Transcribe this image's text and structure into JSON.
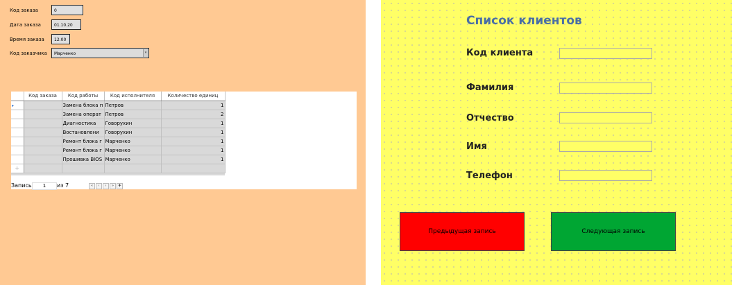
{
  "order_form": {
    "fields": [
      {
        "label": "Код заказа",
        "value": "0"
      },
      {
        "label": "Дата заказа",
        "value": "01.10.20"
      },
      {
        "label": "Время заказа",
        "value": "12:00"
      },
      {
        "label": "Код заказчика",
        "value": "Марченко"
      }
    ],
    "grid": {
      "columns": [
        "Код заказа",
        "Код работы",
        "Код исполнителя",
        "Количество единиц"
      ],
      "rows": [
        {
          "order": "",
          "work": "Замена блока п",
          "executor": "Петров",
          "qty": "1"
        },
        {
          "order": "",
          "work": "Замена операт",
          "executor": "Петров",
          "qty": "2"
        },
        {
          "order": "",
          "work": "Диагностика",
          "executor": "Говорухин",
          "qty": "1"
        },
        {
          "order": "",
          "work": "Востановлени",
          "executor": "Говорухин",
          "qty": "1"
        },
        {
          "order": "",
          "work": "Ремонт блока г",
          "executor": "Марченко",
          "qty": "1"
        },
        {
          "order": "",
          "work": "Ремонт блока г",
          "executor": "Марченко",
          "qty": "1"
        },
        {
          "order": "",
          "work": "Прошивка BIOS",
          "executor": "Марченко",
          "qty": "1"
        }
      ],
      "row_marker": "▸",
      "new_row_marker": "+"
    },
    "navigator": {
      "record_label": "Запись",
      "record_value": "1",
      "of_label": "из 7",
      "buttons": [
        "«",
        "‹",
        "›",
        "»",
        "✚"
      ]
    }
  },
  "client_form": {
    "title": "Список клиентов",
    "fields": [
      {
        "label": "Код клиента",
        "value": ""
      },
      {
        "label": "Фамилия",
        "value": ""
      },
      {
        "label": "Отчество",
        "value": ""
      },
      {
        "label": "Имя",
        "value": ""
      },
      {
        "label": "Телефон",
        "value": ""
      }
    ],
    "prev_button": "Предыдущая запись",
    "next_button": "Следующая запись"
  },
  "colors": {
    "left_bg": "#ffc993",
    "right_bg": "#ffff66",
    "title": "#4a6fa5",
    "prev_button": "#ff0000",
    "next_button": "#00a633"
  }
}
